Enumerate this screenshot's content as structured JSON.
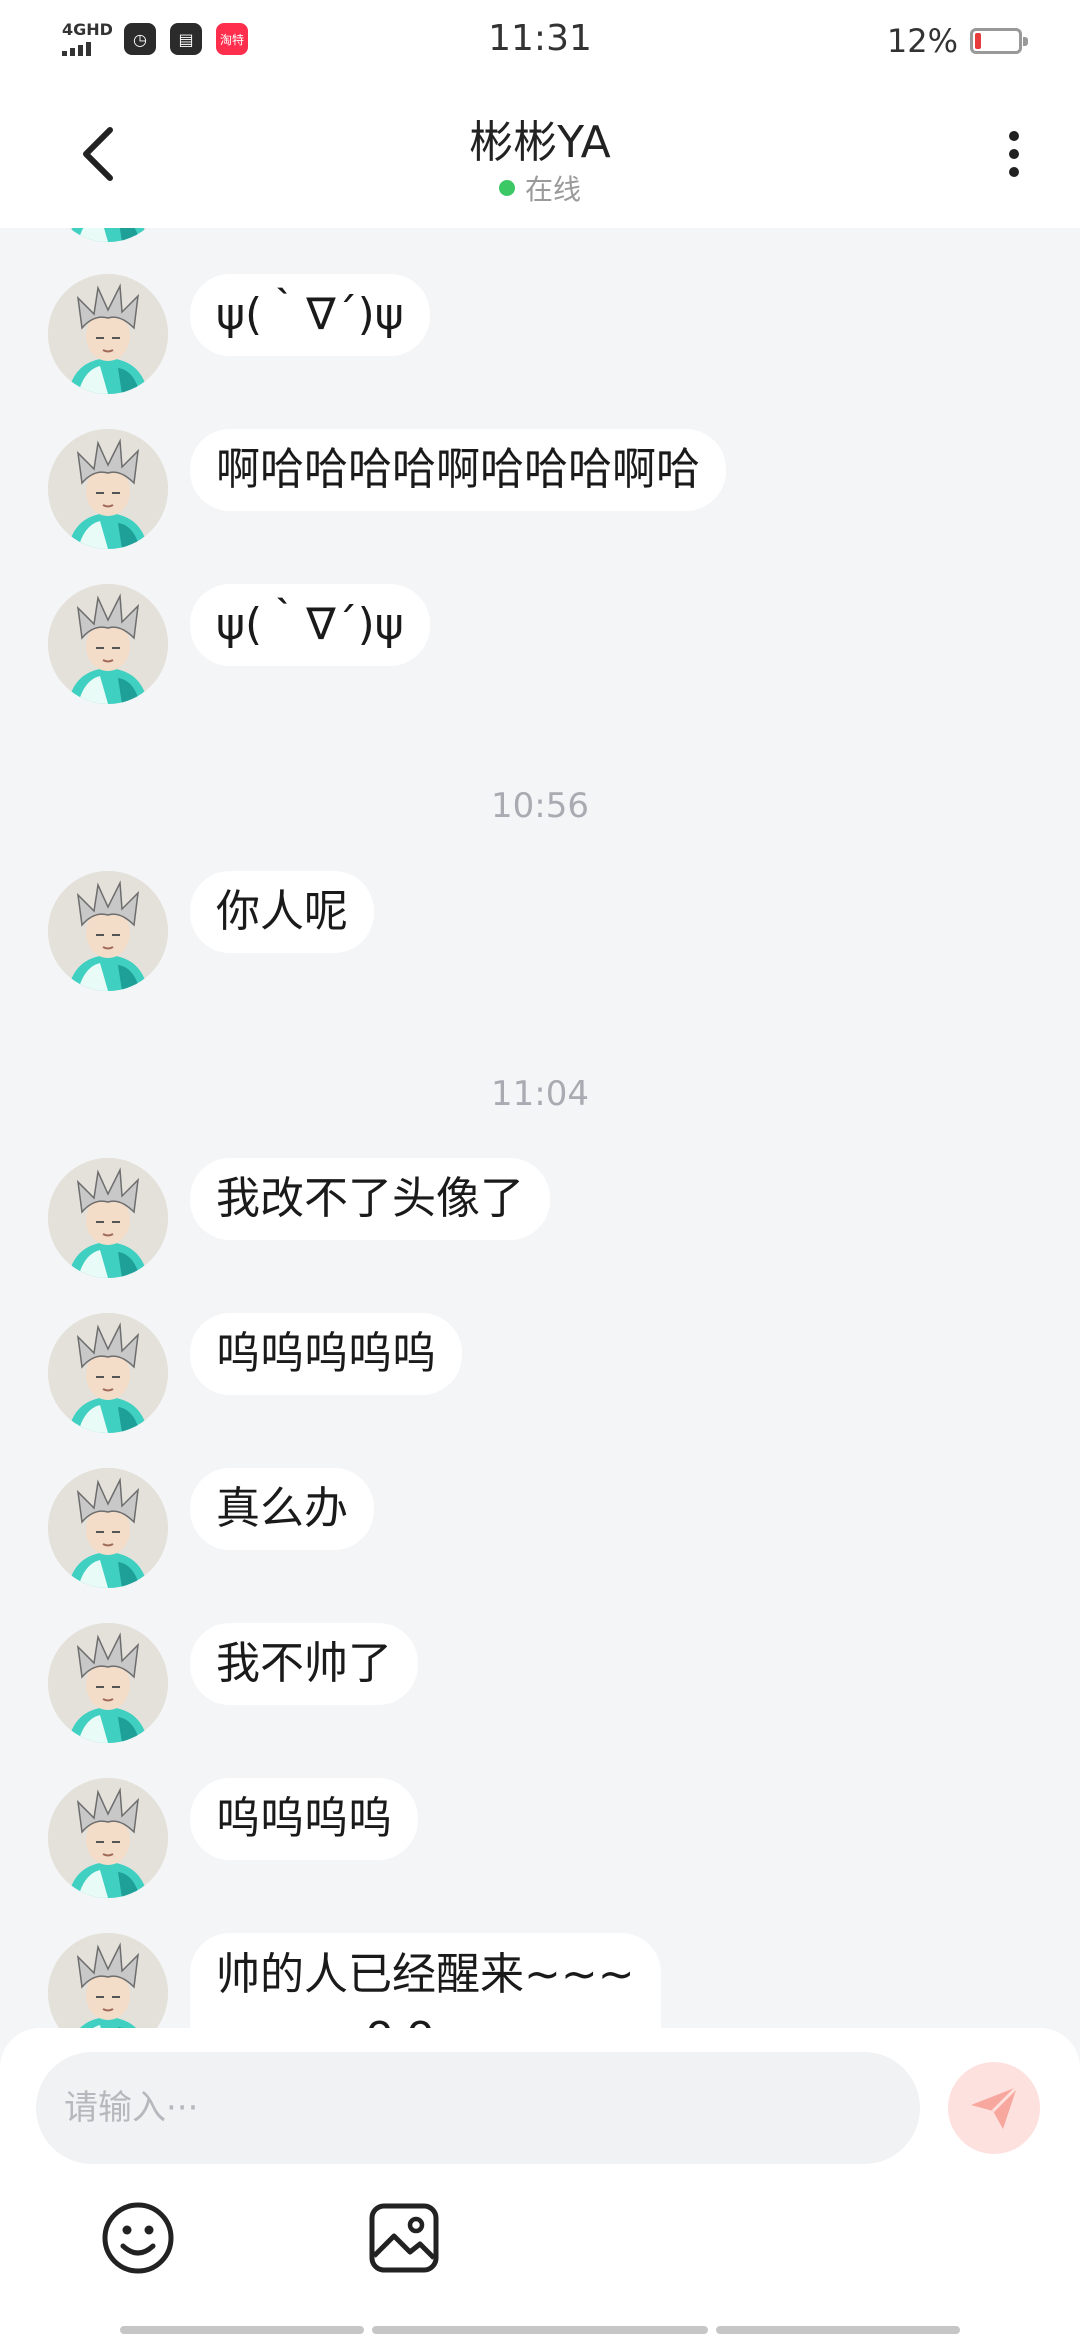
{
  "status_bar": {
    "network": "4GHD",
    "time": "11:31",
    "battery": "12%",
    "battery_level": 0.12,
    "app_icons": [
      "clock-app-icon",
      "wallet-app-icon",
      "taote-app-icon"
    ],
    "red_app_text": "淘特"
  },
  "header": {
    "back_icon": "chevron-left-icon",
    "contact_name": "彬彬YA",
    "status": "在线",
    "status_color": "#3cc864",
    "more_icon": "more-vertical-icon"
  },
  "messages": [
    {
      "type": "text",
      "text": "ψ(｀∇´)ψ"
    },
    {
      "type": "text",
      "text": "啊哈哈哈哈啊哈哈哈啊哈"
    },
    {
      "type": "text",
      "text": "ψ(｀∇´)ψ"
    },
    {
      "type": "time",
      "text": "10:56"
    },
    {
      "type": "text",
      "text": "你人呢"
    },
    {
      "type": "time",
      "text": "11:04"
    },
    {
      "type": "text",
      "text": "我改不了头像了"
    },
    {
      "type": "text",
      "text": "呜呜呜呜呜"
    },
    {
      "type": "text",
      "text": "真么办"
    },
    {
      "type": "text",
      "text": "我不帅了"
    },
    {
      "type": "text",
      "text": "呜呜呜呜"
    },
    {
      "type": "text",
      "text": "帅的人已经醒来~~~",
      "continuation": "o o"
    }
  ],
  "input": {
    "placeholder": "请输入···",
    "value": "",
    "send_icon": "paper-plane-icon",
    "tools": [
      "emoji-icon",
      "image-icon"
    ]
  },
  "colors": {
    "background": "#f4f5f7",
    "bubble": "#ffffff",
    "send_button": "#fde1de",
    "send_icon": "#f7a79d"
  }
}
